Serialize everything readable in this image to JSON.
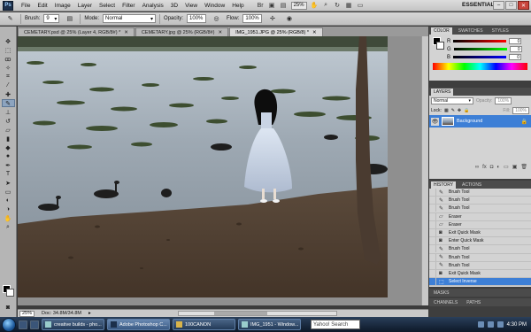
{
  "menubar": {
    "logo": "Ps",
    "items": [
      "File",
      "Edit",
      "Image",
      "Layer",
      "Select",
      "Filter",
      "Analysis",
      "3D",
      "View",
      "Window",
      "Help"
    ],
    "zoom": "25%",
    "workspace": "ESSENTIALS"
  },
  "options": {
    "brush_label": "Brush:",
    "brush_size": "9",
    "mode_label": "Mode:",
    "mode_value": "Normal",
    "opacity_label": "Opacity:",
    "opacity_value": "100%",
    "flow_label": "Flow:",
    "flow_value": "100%"
  },
  "tabs": [
    {
      "label": "CEMETARY.psd @ 25% (Layer 4, RGB/8#) *"
    },
    {
      "label": "CEMETARY.jpg @ 25% (RGB/8#)"
    },
    {
      "label": "IMG_1951.JPG @ 25% (RGB/8) *"
    }
  ],
  "status": {
    "zoom": "25%",
    "doc": "Doc: 34.8M/34.8M"
  },
  "color_panel": {
    "tabs": [
      "COLOR",
      "SWATCHES",
      "STYLES"
    ],
    "rows": [
      {
        "label": "R",
        "value": "0",
        "color": "#d43b3b"
      },
      {
        "label": "G",
        "value": "0",
        "color": "#3bb04a"
      },
      {
        "label": "B",
        "value": "0",
        "color": "#3b5fd4"
      }
    ]
  },
  "layers_panel": {
    "tabs": [
      "LAYERS"
    ],
    "blend_mode": "Normal",
    "opacity_label": "Opacity:",
    "opacity_value": "100%",
    "lock_label": "Lock:",
    "fill_label": "Fill:",
    "fill_value": "100%",
    "layer_name": "Background"
  },
  "history_panel": {
    "tabs": [
      "HISTORY",
      "ACTIONS"
    ],
    "items": [
      {
        "label": "Brush Tool",
        "icon": "brush-icon"
      },
      {
        "label": "Brush Tool",
        "icon": "brush-icon"
      },
      {
        "label": "Brush Tool",
        "icon": "brush-icon"
      },
      {
        "label": "Eraser",
        "icon": "eraser-icon"
      },
      {
        "label": "Eraser",
        "icon": "eraser-icon"
      },
      {
        "label": "Exit Quick Mask",
        "icon": "mask-icon"
      },
      {
        "label": "Enter Quick Mask",
        "icon": "mask-icon"
      },
      {
        "label": "Brush Tool",
        "icon": "brush-icon"
      },
      {
        "label": "Brush Tool",
        "icon": "brush-icon"
      },
      {
        "label": "Brush Tool",
        "icon": "brush-icon"
      },
      {
        "label": "Exit Quick Mask",
        "icon": "mask-icon"
      },
      {
        "label": "Select Inverse",
        "icon": "select-icon",
        "selected": true
      }
    ]
  },
  "bottom_panels": {
    "masks": "MASKS",
    "channels": "CHANNELS",
    "paths": "PATHS"
  },
  "taskbar": {
    "items": [
      {
        "label": "creative builds - pho..."
      },
      {
        "label": "Adobe Photoshop C..."
      },
      {
        "label": "100CANON"
      },
      {
        "label": "IMG_1951 - Window..."
      }
    ],
    "search_placeholder": "Yahoo! Search",
    "time": "4:30 PM"
  },
  "colors": {
    "accent": "#3d7fd6",
    "panel_bg": "#d3d3d3",
    "app_bg": "#3c3c3c"
  }
}
